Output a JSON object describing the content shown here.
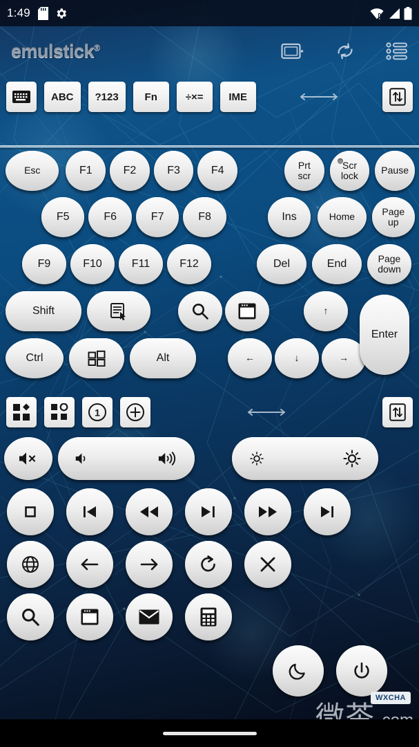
{
  "status_bar": {
    "time": "1:49",
    "left_icons": [
      "sd-card-icon",
      "gear-icon"
    ],
    "right_icons": [
      "wifi-alert-icon",
      "cellular-signal-icon",
      "battery-icon"
    ]
  },
  "header": {
    "logo": "emulstick",
    "trademark": "®",
    "icons": [
      {
        "name": "device-screen-icon",
        "label": "Device"
      },
      {
        "name": "sync-icon",
        "label": "Sync"
      },
      {
        "name": "list-menu-icon",
        "label": "Menu"
      }
    ]
  },
  "toolbar_primary": {
    "buttons": [
      {
        "name": "keyboard-toggle-button",
        "label": "",
        "icon": "keyboard-icon",
        "active": true
      },
      {
        "name": "abc-mode-button",
        "label": "ABC",
        "icon": ""
      },
      {
        "name": "symbols-mode-button",
        "label": "?123",
        "icon": ""
      },
      {
        "name": "fn-mode-button",
        "label": "Fn",
        "icon": ""
      },
      {
        "name": "math-mode-button",
        "label": "÷×=",
        "icon": ""
      },
      {
        "name": "ime-mode-button",
        "label": "IME",
        "icon": ""
      }
    ],
    "scroll_hint": "horizontal-double-arrow-icon",
    "end_button": {
      "name": "swap-layout-button",
      "icon": "up-down-arrows-icon"
    }
  },
  "toolbar_secondary": {
    "buttons": [
      {
        "name": "layout-filled-button",
        "icon": "shapes-filled-icon",
        "active": true
      },
      {
        "name": "layout-outline-button",
        "icon": "shapes-outline-icon"
      },
      {
        "name": "profile-one-button",
        "icon": "circled-1-icon",
        "label": "1"
      },
      {
        "name": "add-profile-button",
        "icon": "circled-plus-icon"
      }
    ],
    "scroll_hint": "horizontal-double-arrow-icon",
    "end_button": {
      "name": "swap-layout-button-2",
      "icon": "up-down-arrows-icon"
    }
  },
  "keyboard": {
    "rows": [
      {
        "name": "function-row-1",
        "keys": [
          {
            "name": "key-esc",
            "label": "Esc",
            "shape": "wide"
          },
          {
            "name": "key-f1",
            "label": "F1",
            "shape": "ell"
          },
          {
            "name": "key-f2",
            "label": "F2",
            "shape": "ell"
          },
          {
            "name": "key-f3",
            "label": "F3",
            "shape": "ell"
          },
          {
            "name": "key-f4",
            "label": "F4",
            "shape": "ell"
          },
          {
            "name": "key-prtscr",
            "label": "Prt\nscr",
            "shape": "ell",
            "small": true
          },
          {
            "name": "key-scrlock",
            "label": "Scr\nlock",
            "shape": "ell",
            "small": true,
            "led": true
          },
          {
            "name": "key-pause",
            "label": "Pause",
            "shape": "ell",
            "small": true
          }
        ]
      },
      {
        "name": "function-row-2",
        "keys": [
          {
            "name": "key-f5",
            "label": "F5",
            "shape": "ell"
          },
          {
            "name": "key-f6",
            "label": "F6",
            "shape": "ell"
          },
          {
            "name": "key-f7",
            "label": "F7",
            "shape": "ell"
          },
          {
            "name": "key-f8",
            "label": "F8",
            "shape": "ell"
          },
          {
            "name": "key-ins",
            "label": "Ins",
            "shape": "ell"
          },
          {
            "name": "key-home",
            "label": "Home",
            "shape": "ell",
            "small": true
          },
          {
            "name": "key-pageup",
            "label": "Page\nup",
            "shape": "ell",
            "small": true
          }
        ]
      },
      {
        "name": "function-row-3",
        "keys": [
          {
            "name": "key-f9",
            "label": "F9",
            "shape": "ell"
          },
          {
            "name": "key-f10",
            "label": "F10",
            "shape": "ell"
          },
          {
            "name": "key-f11",
            "label": "F11",
            "shape": "ell"
          },
          {
            "name": "key-f12",
            "label": "F12",
            "shape": "ell"
          },
          {
            "name": "key-del",
            "label": "Del",
            "shape": "ell"
          },
          {
            "name": "key-end",
            "label": "End",
            "shape": "ell"
          },
          {
            "name": "key-pagedown",
            "label": "Page\ndown",
            "shape": "ell",
            "small": true
          }
        ]
      },
      {
        "name": "modifier-row-1",
        "keys": [
          {
            "name": "key-shift",
            "label": "Shift",
            "shape": "pill"
          },
          {
            "name": "key-context-menu",
            "label": "",
            "icon": "context-menu-icon",
            "shape": "pill"
          },
          {
            "name": "key-search",
            "label": "",
            "icon": "search-icon",
            "shape": "ell"
          },
          {
            "name": "key-window",
            "label": "",
            "icon": "window-icon",
            "shape": "ell"
          },
          {
            "name": "key-arrow-up",
            "label": "↑",
            "shape": "ell"
          }
        ]
      },
      {
        "name": "modifier-row-2",
        "keys": [
          {
            "name": "key-ctrl",
            "label": "Ctrl",
            "shape": "wide"
          },
          {
            "name": "key-windows",
            "label": "",
            "icon": "windows-logo-icon",
            "shape": "pill"
          },
          {
            "name": "key-alt",
            "label": "Alt",
            "shape": "pill"
          },
          {
            "name": "key-arrow-left",
            "label": "←",
            "shape": "ell"
          },
          {
            "name": "key-arrow-down",
            "label": "↓",
            "shape": "ell"
          },
          {
            "name": "key-arrow-right",
            "label": "→",
            "shape": "ell"
          }
        ]
      }
    ],
    "enter_key": {
      "name": "key-enter",
      "label": "Enter"
    }
  },
  "media_panel": {
    "volume_row": [
      {
        "name": "mute-button",
        "icon": "speaker-mute-icon"
      },
      {
        "name": "volume-down-button",
        "icon": "speaker-low-icon"
      },
      {
        "name": "volume-up-button",
        "icon": "speaker-high-icon"
      },
      {
        "name": "brightness-down-button",
        "icon": "brightness-low-icon"
      },
      {
        "name": "brightness-up-button",
        "icon": "brightness-high-icon"
      }
    ],
    "transport_row": [
      {
        "name": "stop-button",
        "icon": "stop-icon"
      },
      {
        "name": "previous-track-button",
        "icon": "previous-icon"
      },
      {
        "name": "rewind-button",
        "icon": "rewind-icon"
      },
      {
        "name": "play-pause-button",
        "icon": "play-pause-icon"
      },
      {
        "name": "fast-forward-button",
        "icon": "fast-forward-icon"
      },
      {
        "name": "next-track-button",
        "icon": "next-icon"
      }
    ],
    "browser_row": [
      {
        "name": "browser-home-button",
        "icon": "globe-icon"
      },
      {
        "name": "browser-back-button",
        "icon": "arrow-left-icon"
      },
      {
        "name": "browser-forward-button",
        "icon": "arrow-right-icon"
      },
      {
        "name": "browser-refresh-button",
        "icon": "refresh-icon"
      },
      {
        "name": "browser-stop-button",
        "icon": "close-x-icon"
      }
    ],
    "apps_row": [
      {
        "name": "app-search-button",
        "icon": "search-icon"
      },
      {
        "name": "app-my-computer-button",
        "icon": "window-icon"
      },
      {
        "name": "app-mail-button",
        "icon": "mail-icon"
      },
      {
        "name": "app-calculator-button",
        "icon": "calculator-icon"
      }
    ],
    "power_row": [
      {
        "name": "sleep-button",
        "icon": "moon-icon"
      },
      {
        "name": "power-button",
        "icon": "power-icon"
      }
    ]
  },
  "watermark": {
    "text_cn": "微茶",
    "text_domain": ".com",
    "badge": "WXCHA"
  },
  "colors": {
    "bg_deep": "#0a1c35",
    "bg_blue": "#0b4c80",
    "key_face": "#f0f0f0",
    "status_bar": "#060c1a"
  }
}
